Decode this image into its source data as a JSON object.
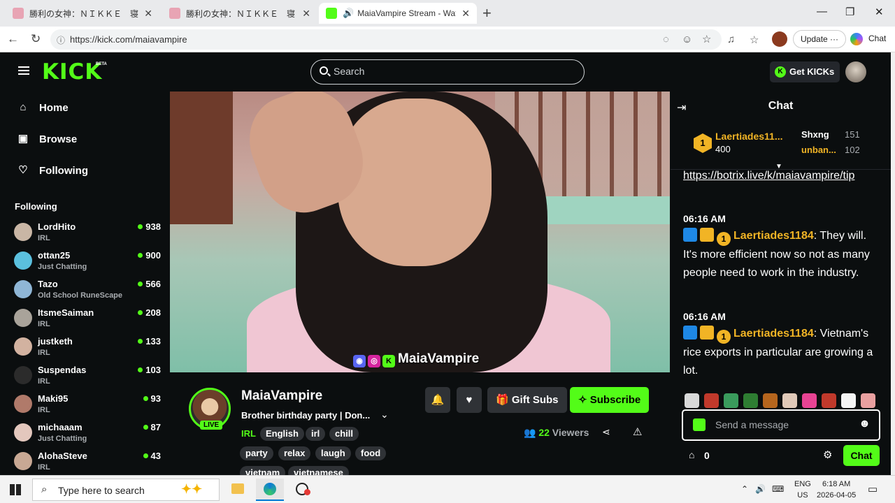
{
  "browser": {
    "tabs": [
      {
        "title": "勝利の女神：ＮＩＫＫＥ　寝ころびバ"
      },
      {
        "title": "勝利の女神：ＮＩＫＫＥ　寝ころびバ"
      },
      {
        "title": "MaiaVampire Stream - Watch"
      }
    ],
    "url": "https://kick.com/maiavampire",
    "update_label": "Update",
    "chat_label": "Chat"
  },
  "header": {
    "logo": "KICK",
    "logo_badge": "BETA",
    "search_placeholder": "Search",
    "get_kicks": "Get KICKs"
  },
  "sidebar": {
    "nav": [
      {
        "label": "Home",
        "icon": "home-icon"
      },
      {
        "label": "Browse",
        "icon": "browse-icon"
      },
      {
        "label": "Following",
        "icon": "heart-icon"
      }
    ],
    "following_title": "Following",
    "following": [
      {
        "name": "LordHito",
        "category": "IRL",
        "viewers": "938"
      },
      {
        "name": "ottan25",
        "category": "Just Chatting",
        "viewers": "900"
      },
      {
        "name": "Tazo",
        "category": "Old School RuneScape",
        "viewers": "566"
      },
      {
        "name": "ItsmeSaiman",
        "category": "IRL",
        "viewers": "208"
      },
      {
        "name": "justketh",
        "category": "IRL",
        "viewers": "133"
      },
      {
        "name": "Suspendas",
        "category": "IRL",
        "viewers": "103"
      },
      {
        "name": "Maki95",
        "category": "IRL",
        "viewers": "93"
      },
      {
        "name": "michaaam",
        "category": "Just Chatting",
        "viewers": "87"
      },
      {
        "name": "AlohaSteve",
        "category": "IRL",
        "viewers": "43"
      }
    ]
  },
  "video": {
    "overlay_name": "MaiaVampire"
  },
  "channel": {
    "name": "MaiaVampire",
    "live_label": "LIVE",
    "title": "Brother birthday party | Don...",
    "category": "IRL",
    "tags": [
      "English",
      "irl",
      "chill",
      "party",
      "relax",
      "laugh",
      "food",
      "vietnam",
      "vietnamese"
    ],
    "gift_subs": "Gift Subs",
    "subscribe": "Subscribe",
    "viewer_count": "22",
    "viewers_label": "Viewers"
  },
  "chat": {
    "title": "Chat",
    "leaderboard": [
      {
        "rank": "1",
        "name": "Laertiades11...",
        "amount": "400"
      },
      {
        "name": "Shxng",
        "amount": "151"
      },
      {
        "name": "unban...",
        "amount": "102"
      }
    ],
    "link_text": "https://botrix.live/k/maiavampire/tip",
    "messages": [
      {
        "time": "06:16 AM",
        "user": "Laertiades1184",
        "text": ": They will. It's more efficient now so not as many people need to work in the industry."
      },
      {
        "time": "06:16 AM",
        "user": "Laertiades1184",
        "text": ": Vietnam's rice exports in particular are growing a lot."
      }
    ],
    "input_placeholder": "Send a message",
    "kicks_count": "0",
    "send_label": "Chat"
  },
  "taskbar": {
    "search_placeholder": "Type here to search",
    "lang": "ENG",
    "region": "US",
    "time": "6:18 AM",
    "date": "2026-04-05"
  },
  "colors": {
    "brand_green": "#53fc18",
    "gold": "#f1b425",
    "background": "#0b0e0f"
  }
}
